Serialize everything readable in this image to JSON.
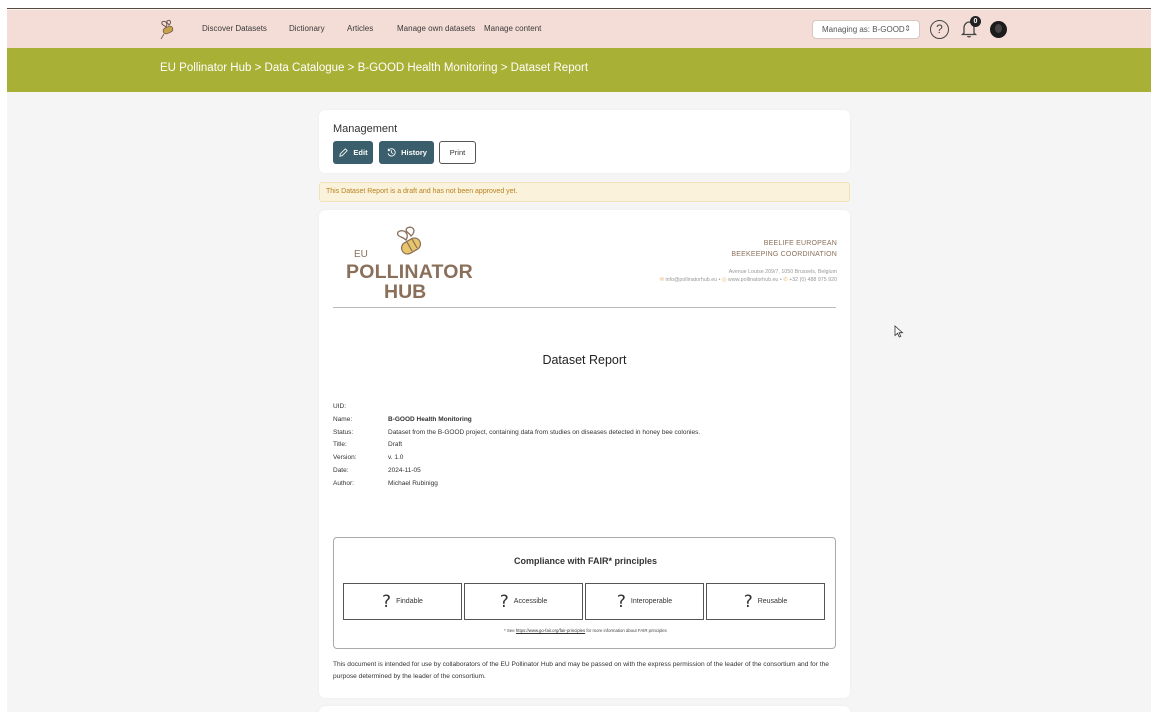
{
  "nav": {
    "links": [
      "Discover Datasets",
      "Dictionary",
      "Articles",
      "Manage own datasets",
      "Manage content"
    ],
    "managing_label": "Managing as: B-GOOD",
    "notification_count": "0"
  },
  "breadcrumb": {
    "items": [
      "EU Pollinator Hub",
      "Data Catalogue",
      "B-GOOD Health Monitoring",
      "Dataset Report"
    ],
    "separator": ">"
  },
  "management": {
    "title": "Management",
    "edit_label": "Edit",
    "history_label": "History",
    "print_label": "Print"
  },
  "alert": "This Dataset Report is a draft and has not been approved yet.",
  "report": {
    "logo": {
      "eu": "EU",
      "pollinator": "POLLINATOR",
      "hub": "HUB"
    },
    "org": {
      "name_line1": "BEELIFE EUROPEAN",
      "name_line2": "BEEKEEPING COORDINATION",
      "address": "Avenue Louise 209/7, 1050 Brussels, Belgium",
      "email": "info@pollinatorhub.eu",
      "website": "www.pollinatorhub.eu",
      "phone": "+32 (0) 488 975 920"
    },
    "title": "Dataset Report",
    "meta": [
      {
        "key": "UID:",
        "value": ""
      },
      {
        "key": "Name:",
        "value": "B-GOOD Health Monitoring"
      },
      {
        "key": "Status:",
        "value": "Dataset from the B-GOOD project, containing data from studies on diseases detected in honey bee colonies."
      },
      {
        "key": "Title:",
        "value": "Draft"
      },
      {
        "key": "Version:",
        "value": "v. 1.0"
      },
      {
        "key": "Date:",
        "value": "2024-11-05"
      },
      {
        "key": "Author:",
        "value": "Michael Rubinigg"
      }
    ],
    "fair": {
      "title": "Compliance with FAIR* principles",
      "items": [
        "Findable",
        "Accessible",
        "Interoperable",
        "Reusable"
      ],
      "symbol": "?",
      "note_prefix": "* See",
      "note_link": "https://www.go-fair.org/fair-principles",
      "note_suffix": "for more information about FAIR principles"
    },
    "disclaimer": "This document is intended for use by collaborators of the EU Pollinator Hub and may be passed on with the express permission of the leader of the consortium and for the purpose determined by the leader of the consortium."
  },
  "colors": {
    "nav_bg": "#f4ddd6",
    "breadcrumb_bg": "#a8b035",
    "button_dark": "#3a5e6c",
    "brand_brown": "#8a6f5a",
    "alert_text": "#b8821d"
  }
}
